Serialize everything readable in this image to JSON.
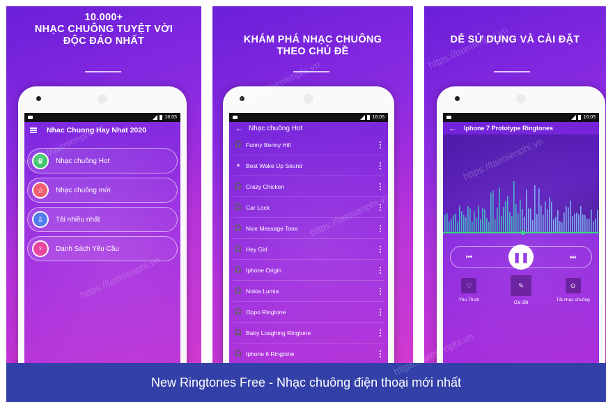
{
  "panels": {
    "p1": {
      "headline": [
        "10.000+",
        "NHẠC CHUÔNG TUYỆT VỜI",
        "ĐỘC ĐÁO NHẤT"
      ]
    },
    "p2": {
      "headline": [
        "KHÁM PHÁ NHẠC CHUÔNG",
        "THEO CHỦ ĐỀ"
      ]
    },
    "p3": {
      "headline": [
        "DỄ SỬ DỤNG VÀ CÀI ĐẶT"
      ]
    }
  },
  "status_time": "16:05",
  "screen1": {
    "title": "Nhac Chuong Hay Nhat 2020",
    "menu": [
      {
        "label": "Nhạc chuông Hot",
        "icon": "trophy-icon",
        "glyph": "♛",
        "color": "#3cc46c"
      },
      {
        "label": "Nhạc chuông mới",
        "icon": "star-icon",
        "glyph": "☆",
        "color": "#ef5a6f"
      },
      {
        "label": "Tải nhiều nhất",
        "icon": "download-icon",
        "glyph": "⇩",
        "color": "#4d78f0"
      },
      {
        "label": "Danh Sách Yêu Cầu",
        "icon": "user-icon",
        "glyph": "♀",
        "color": "#e8409a"
      }
    ]
  },
  "screen2": {
    "title": "Nhạc chuông Hot",
    "songs": [
      {
        "name": "Funny Benny Hill",
        "icon": "headphones-icon",
        "glyph": "🎧"
      },
      {
        "name": "Best Wake Up Sound",
        "icon": "pause-icon",
        "glyph": "⏸"
      },
      {
        "name": "Crazy Chicken",
        "icon": "headphones-icon",
        "glyph": "🎧"
      },
      {
        "name": "Car Lock",
        "icon": "headphones-icon",
        "glyph": "🎧"
      },
      {
        "name": "Nice Message Tone",
        "icon": "headphones-icon",
        "glyph": "🎧"
      },
      {
        "name": "Hey Girl",
        "icon": "headphones-icon",
        "glyph": "🎧"
      },
      {
        "name": "Iphone Origin",
        "icon": "headphones-icon",
        "glyph": "🎧"
      },
      {
        "name": "Nokia Lumia",
        "icon": "headphones-icon",
        "glyph": "🎧"
      },
      {
        "name": "Oppo Ringtone",
        "icon": "headphones-icon",
        "glyph": "🎧"
      },
      {
        "name": "Baby Loughing Ringtone",
        "icon": "headphones-icon",
        "glyph": "🎧"
      },
      {
        "name": "Iphone 6 Ringtone",
        "icon": "headphones-icon",
        "glyph": "🎧"
      }
    ]
  },
  "screen3": {
    "title": "Iphone 7 Prototype Ringtones",
    "progress": 0.5,
    "actions": [
      {
        "label": "Yêu Thích",
        "icon": "heart-icon",
        "glyph": "♡"
      },
      {
        "label": "Cài đặt",
        "icon": "install-icon",
        "glyph": "✎"
      },
      {
        "label": "Tải nhạc chuông",
        "icon": "download-circle-icon",
        "glyph": "⊙"
      }
    ]
  },
  "footer": "New Ringtones Free - Nhạc chuông điện thoại mới nhất",
  "watermark": "https://taimienphi.vn"
}
